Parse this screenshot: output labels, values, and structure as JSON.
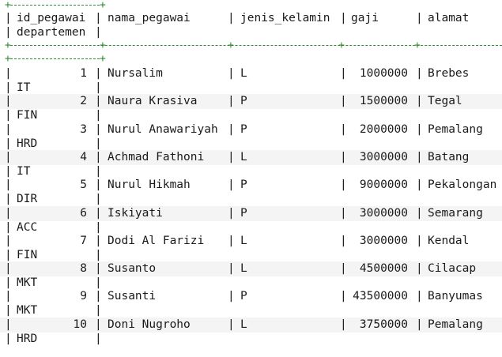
{
  "table": {
    "headers": {
      "id": "id_pegawai",
      "id_wrap": "departemen",
      "nama": "nama_pegawai",
      "jk": "jenis_kelamin",
      "gaji": "gaji",
      "alamat": "alamat"
    },
    "rows": [
      {
        "id": "1",
        "nama": "Nursalim",
        "jk": "L",
        "gaji": "1000000",
        "alamat": "Brebes",
        "dept": "IT"
      },
      {
        "id": "2",
        "nama": "Naura Krasiva",
        "jk": "P",
        "gaji": "1500000",
        "alamat": "Tegal",
        "dept": "FIN"
      },
      {
        "id": "3",
        "nama": "Nurul Anawariyah",
        "jk": "P",
        "gaji": "2000000",
        "alamat": "Pemalang",
        "dept": "HRD"
      },
      {
        "id": "4",
        "nama": "Achmad Fathoni",
        "jk": "L",
        "gaji": "3000000",
        "alamat": "Batang",
        "dept": "IT"
      },
      {
        "id": "5",
        "nama": "Nurul Hikmah",
        "jk": "P",
        "gaji": "9000000",
        "alamat": "Pekalongan",
        "dept": "DIR"
      },
      {
        "id": "6",
        "nama": "Iskiyati",
        "jk": "P",
        "gaji": "3000000",
        "alamat": "Semarang",
        "dept": "ACC"
      },
      {
        "id": "7",
        "nama": "Dodi Al Farizi",
        "jk": "L",
        "gaji": "3000000",
        "alamat": "Kendal",
        "dept": "FIN"
      },
      {
        "id": "8",
        "nama": "Susanto",
        "jk": "L",
        "gaji": "4500000",
        "alamat": "Cilacap",
        "dept": "MKT"
      },
      {
        "id": "9",
        "nama": "Susanti",
        "jk": "P",
        "gaji": "43500000",
        "alamat": "Banyumas",
        "dept": "MKT"
      },
      {
        "id": "10",
        "nama": "Doni Nugroho",
        "jk": "L",
        "gaji": "3750000",
        "alamat": "Pemalang",
        "dept": "HRD"
      }
    ]
  },
  "colors": {
    "border": "#2e8b2e",
    "text": "#1a1a1a"
  }
}
